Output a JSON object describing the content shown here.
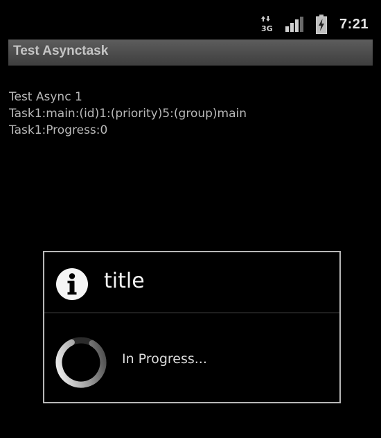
{
  "status_bar": {
    "network_label": "3G",
    "time": "7:21"
  },
  "app": {
    "title": "Test Asynctask"
  },
  "content": {
    "lines": [
      "Test Async 1",
      "Task1:main:(id)1:(priority)5:(group)main",
      "Task1:Progress:0"
    ]
  },
  "dialog": {
    "title": "title",
    "message": "In Progress...",
    "icon": "info-icon"
  },
  "colors": {
    "background": "#000000",
    "title_bar": "#4a4a4a",
    "text": "#b9b9b9",
    "dialog_border": "#b8b8b8"
  }
}
